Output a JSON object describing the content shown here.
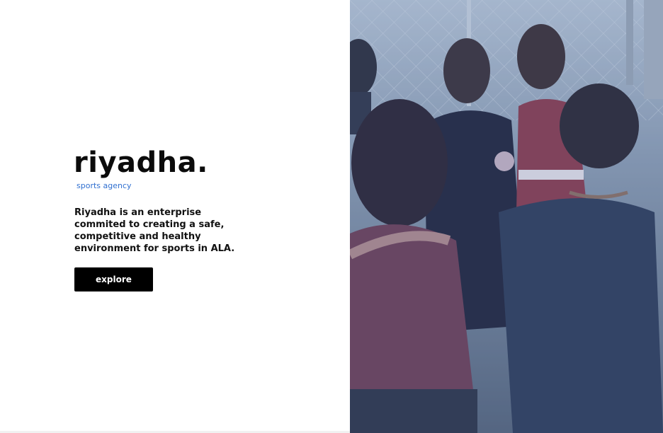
{
  "brand": {
    "title": "riyadha.",
    "subtitle": "sports agency"
  },
  "hero": {
    "description": "Riyadha is an enterprise commited to creating a safe, competitive and healthy environment for sports in ALA.",
    "button_label": "explore"
  },
  "image": {
    "subject": "group of young people gathered on a sports court",
    "overlay_color": "#4d6fa8"
  },
  "colors": {
    "brand_text": "#0b0b0b",
    "accent": "#2f6fd0",
    "button_bg": "#000000",
    "button_text": "#ffffff"
  }
}
